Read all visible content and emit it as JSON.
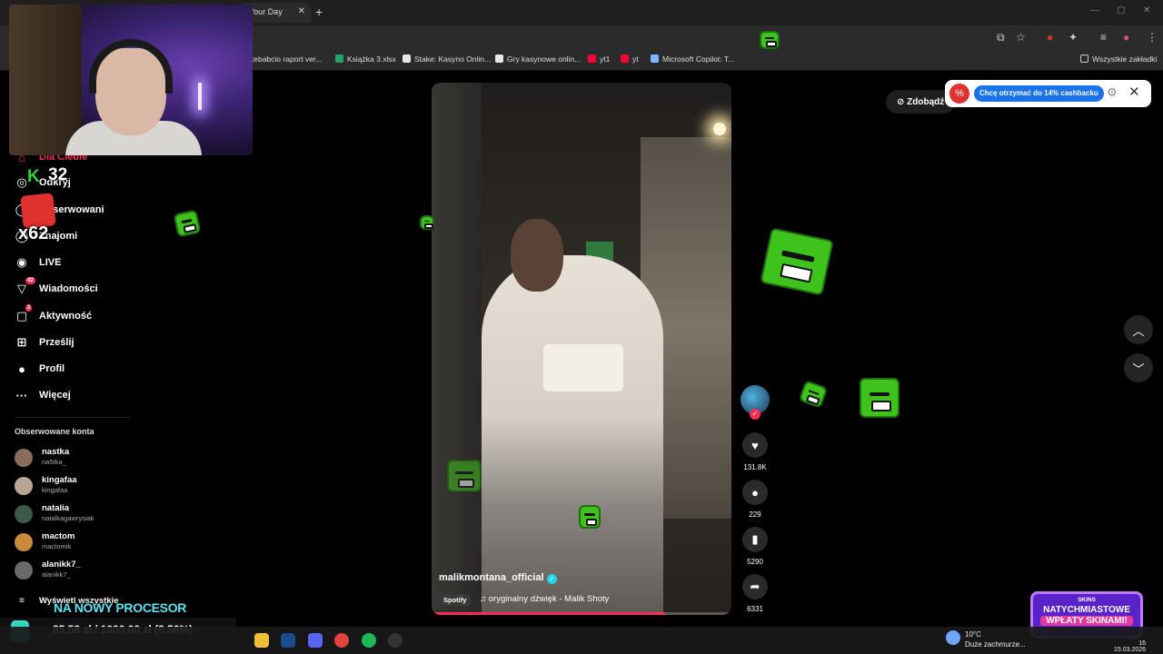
{
  "browser": {
    "tab_title": "Your Day",
    "tab_close": "✕",
    "new_tab": "+",
    "bookmarks": [
      {
        "label": "kebabcio raport ver...",
        "color": "#3aa757"
      },
      {
        "label": "Książka 3.xlsx",
        "color": "#21a366"
      },
      {
        "label": "Stake: Kasyno Onlin...",
        "color": "#e8e8e8"
      },
      {
        "label": "Gry kasynowe onlin...",
        "color": "#e8e8e8"
      },
      {
        "label": "yt1",
        "color": "#ff0033"
      },
      {
        "label": "yt",
        "color": "#ff0033"
      },
      {
        "label": "Microsoft Copilot: T...",
        "color": "#7ab8ff"
      }
    ],
    "all_bookmarks": "Wszystkie zakładki"
  },
  "sidebar": {
    "nav": [
      {
        "label": "Dla Ciebie",
        "icon": "home-icon",
        "glyph": "⌂"
      },
      {
        "label": "Odkryj",
        "icon": "compass-icon",
        "glyph": "◎"
      },
      {
        "label": "Obserwowani",
        "icon": "following-icon",
        "glyph": "◯"
      },
      {
        "label": "Znajomi",
        "icon": "friends-icon",
        "glyph": "◯"
      },
      {
        "label": "LIVE",
        "icon": "live-icon",
        "glyph": "◉"
      },
      {
        "label": "Wiadomości",
        "icon": "messages-icon",
        "glyph": "▽",
        "badge": "42"
      },
      {
        "label": "Aktywność",
        "icon": "activity-icon",
        "glyph": "▢",
        "badge": "2"
      },
      {
        "label": "Prześlij",
        "icon": "upload-icon",
        "glyph": "⊞"
      },
      {
        "label": "Profil",
        "icon": "profile-icon",
        "glyph": "●"
      },
      {
        "label": "Więcej",
        "icon": "more-icon",
        "glyph": "···"
      }
    ],
    "followed_title": "Obserwowane konta",
    "accounts": [
      {
        "name": "nastka",
        "handle": "na5tka_",
        "color": "#8a6d5a"
      },
      {
        "name": "kingafaa",
        "handle": "kingafaa",
        "color": "#b9a596"
      },
      {
        "name": "natalia",
        "handle": "natalkagawrysiak",
        "color": "#3c5a4a"
      },
      {
        "name": "mactom",
        "handle": "mactomik",
        "color": "#c98a3a"
      },
      {
        "name": "alanikk7_",
        "handle": "alanikk7_",
        "color": "#6a6a6a"
      }
    ],
    "show_all": "Wyświetl wszystkie"
  },
  "stream_overlay": {
    "counter": "32",
    "k_letter": "K",
    "multiplier": "x62",
    "goal_title": "NA NOWY PROCESOR",
    "goal_amount": "85,58 zł / 1000,00 zł (8.56%)"
  },
  "video": {
    "author": "malikmontana_official",
    "verified": "✓",
    "spotify": "Spotify",
    "sound": "♫  oryginalny dźwięk - Malik Shoty",
    "progress": 0.78
  },
  "actions": {
    "likes": "131.8K",
    "comments": "229",
    "saves": "5290",
    "shares": "6331",
    "follow": "✓"
  },
  "popups": {
    "zdobadz": "⊘ Zdobądź",
    "cashback_cta": "Chcę otrzymać do 14% cashbacku"
  },
  "ad": {
    "brand": "SKINS",
    "line1": "NATYCHMIASTOWE",
    "line2": "WPŁATY SKINAMI!"
  },
  "taskbar": {
    "temp": "10°C",
    "weather": "Duże zachmurze...",
    "time": "16",
    "date": "15.03.2026"
  }
}
